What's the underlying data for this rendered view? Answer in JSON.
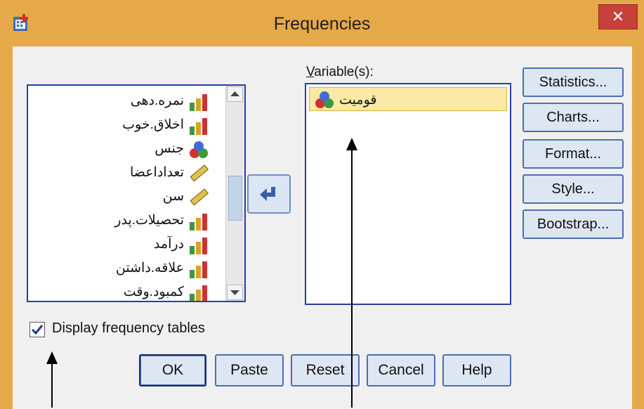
{
  "window": {
    "title": "Frequencies",
    "close_glyph": "✕"
  },
  "source_list": {
    "items": [
      {
        "label": "نمره.دهی",
        "icon": "scale-bar-icon"
      },
      {
        "label": "اخلاق.خوب",
        "icon": "scale-bar-icon"
      },
      {
        "label": "جنس",
        "icon": "nominal-circles-icon"
      },
      {
        "label": "تعداداعضا",
        "icon": "ruler-icon"
      },
      {
        "label": "سن",
        "icon": "ruler-icon"
      },
      {
        "label": "تحصیلات.پدر",
        "icon": "scale-bar-icon"
      },
      {
        "label": "درآمد",
        "icon": "scale-bar-icon"
      },
      {
        "label": "علاقه.داشتن",
        "icon": "scale-bar-icon"
      },
      {
        "label": "کمبود.وقت",
        "icon": "scale-bar-icon"
      }
    ]
  },
  "variables": {
    "label": "Variable(s):",
    "items": [
      {
        "label": "قومیت",
        "icon": "nominal-circles-icon"
      }
    ]
  },
  "side_buttons": {
    "statistics": "Statistics...",
    "charts": "Charts...",
    "format": "Format...",
    "style": "Style...",
    "bootstrap": "Bootstrap..."
  },
  "checkbox": {
    "label": "Display frequency tables",
    "checked": true
  },
  "bottom_buttons": {
    "ok": "OK",
    "paste": "Paste",
    "reset": "Reset",
    "cancel": "Cancel",
    "help": "Help"
  },
  "colors": {
    "accent_border": "#2c3fa0",
    "title_bar": "#e6a94a",
    "close_red": "#c7403a",
    "selected_item": "#fce9a6"
  }
}
